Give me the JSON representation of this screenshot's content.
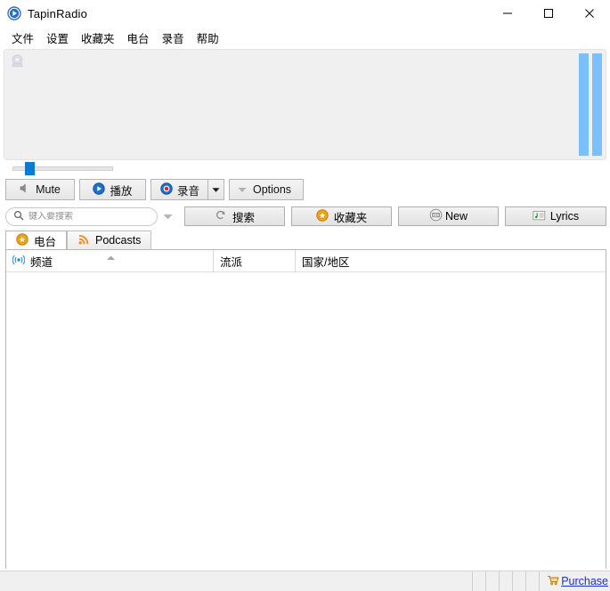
{
  "window": {
    "title": "TapinRadio",
    "app_icon": "play-circle-icon",
    "controls": {
      "minimize": "minimize-icon",
      "maximize": "maximize-icon",
      "close": "close-icon"
    }
  },
  "menubar": {
    "items": [
      {
        "label": "文件"
      },
      {
        "label": "设置"
      },
      {
        "label": "收藏夹"
      },
      {
        "label": "电台"
      },
      {
        "label": "录音"
      },
      {
        "label": "帮助"
      }
    ]
  },
  "visualizer": {
    "icon": "radio-speaker-icon",
    "meter_color": "#7cc0fb",
    "meters": [
      {
        "level": 100
      },
      {
        "level": 100
      }
    ],
    "panel_color": "#f0f0f0"
  },
  "volume": {
    "label": "volume-slider",
    "value": 12,
    "thumb_color": "#0a7bd4"
  },
  "toolbar": {
    "mute_label": "Mute",
    "mute_icon": "speaker-mute-icon",
    "play_label": "播放",
    "play_icon": "play-icon",
    "record_label": "录音",
    "record_icon": "record-icon",
    "record_dropdown_icon": "chevron-down-icon",
    "options_label": "Options",
    "options_icon": "chevron-down-icon"
  },
  "search": {
    "placeholder": "键入要搜索",
    "value": "",
    "icon": "search-icon",
    "dropdown_icon": "chevron-down-icon"
  },
  "actions": {
    "search_label": "搜索",
    "search_icon": "search-spiral-icon",
    "favorites_label": "收藏夹",
    "favorites_icon": "star-icon",
    "new_label": "New",
    "new_icon": "radio-icon",
    "lyrics_label": "Lyrics",
    "lyrics_icon": "music-note-icon"
  },
  "tabs": [
    {
      "label": "电台",
      "icon": "star-icon",
      "active": true
    },
    {
      "label": "Podcasts",
      "icon": "rss-icon",
      "active": false
    }
  ],
  "list": {
    "columns": [
      {
        "label": "频道",
        "icon": "broadcast-icon",
        "sorted": "asc"
      },
      {
        "label": "流派",
        "icon": "",
        "sorted": ""
      },
      {
        "label": "国家/地区",
        "icon": "",
        "sorted": ""
      }
    ],
    "rows": []
  },
  "statusbar": {
    "message": "",
    "purchase_label": "Purchase",
    "purchase_icon": "cart-icon",
    "purchase_color": "#1a2fd0"
  }
}
